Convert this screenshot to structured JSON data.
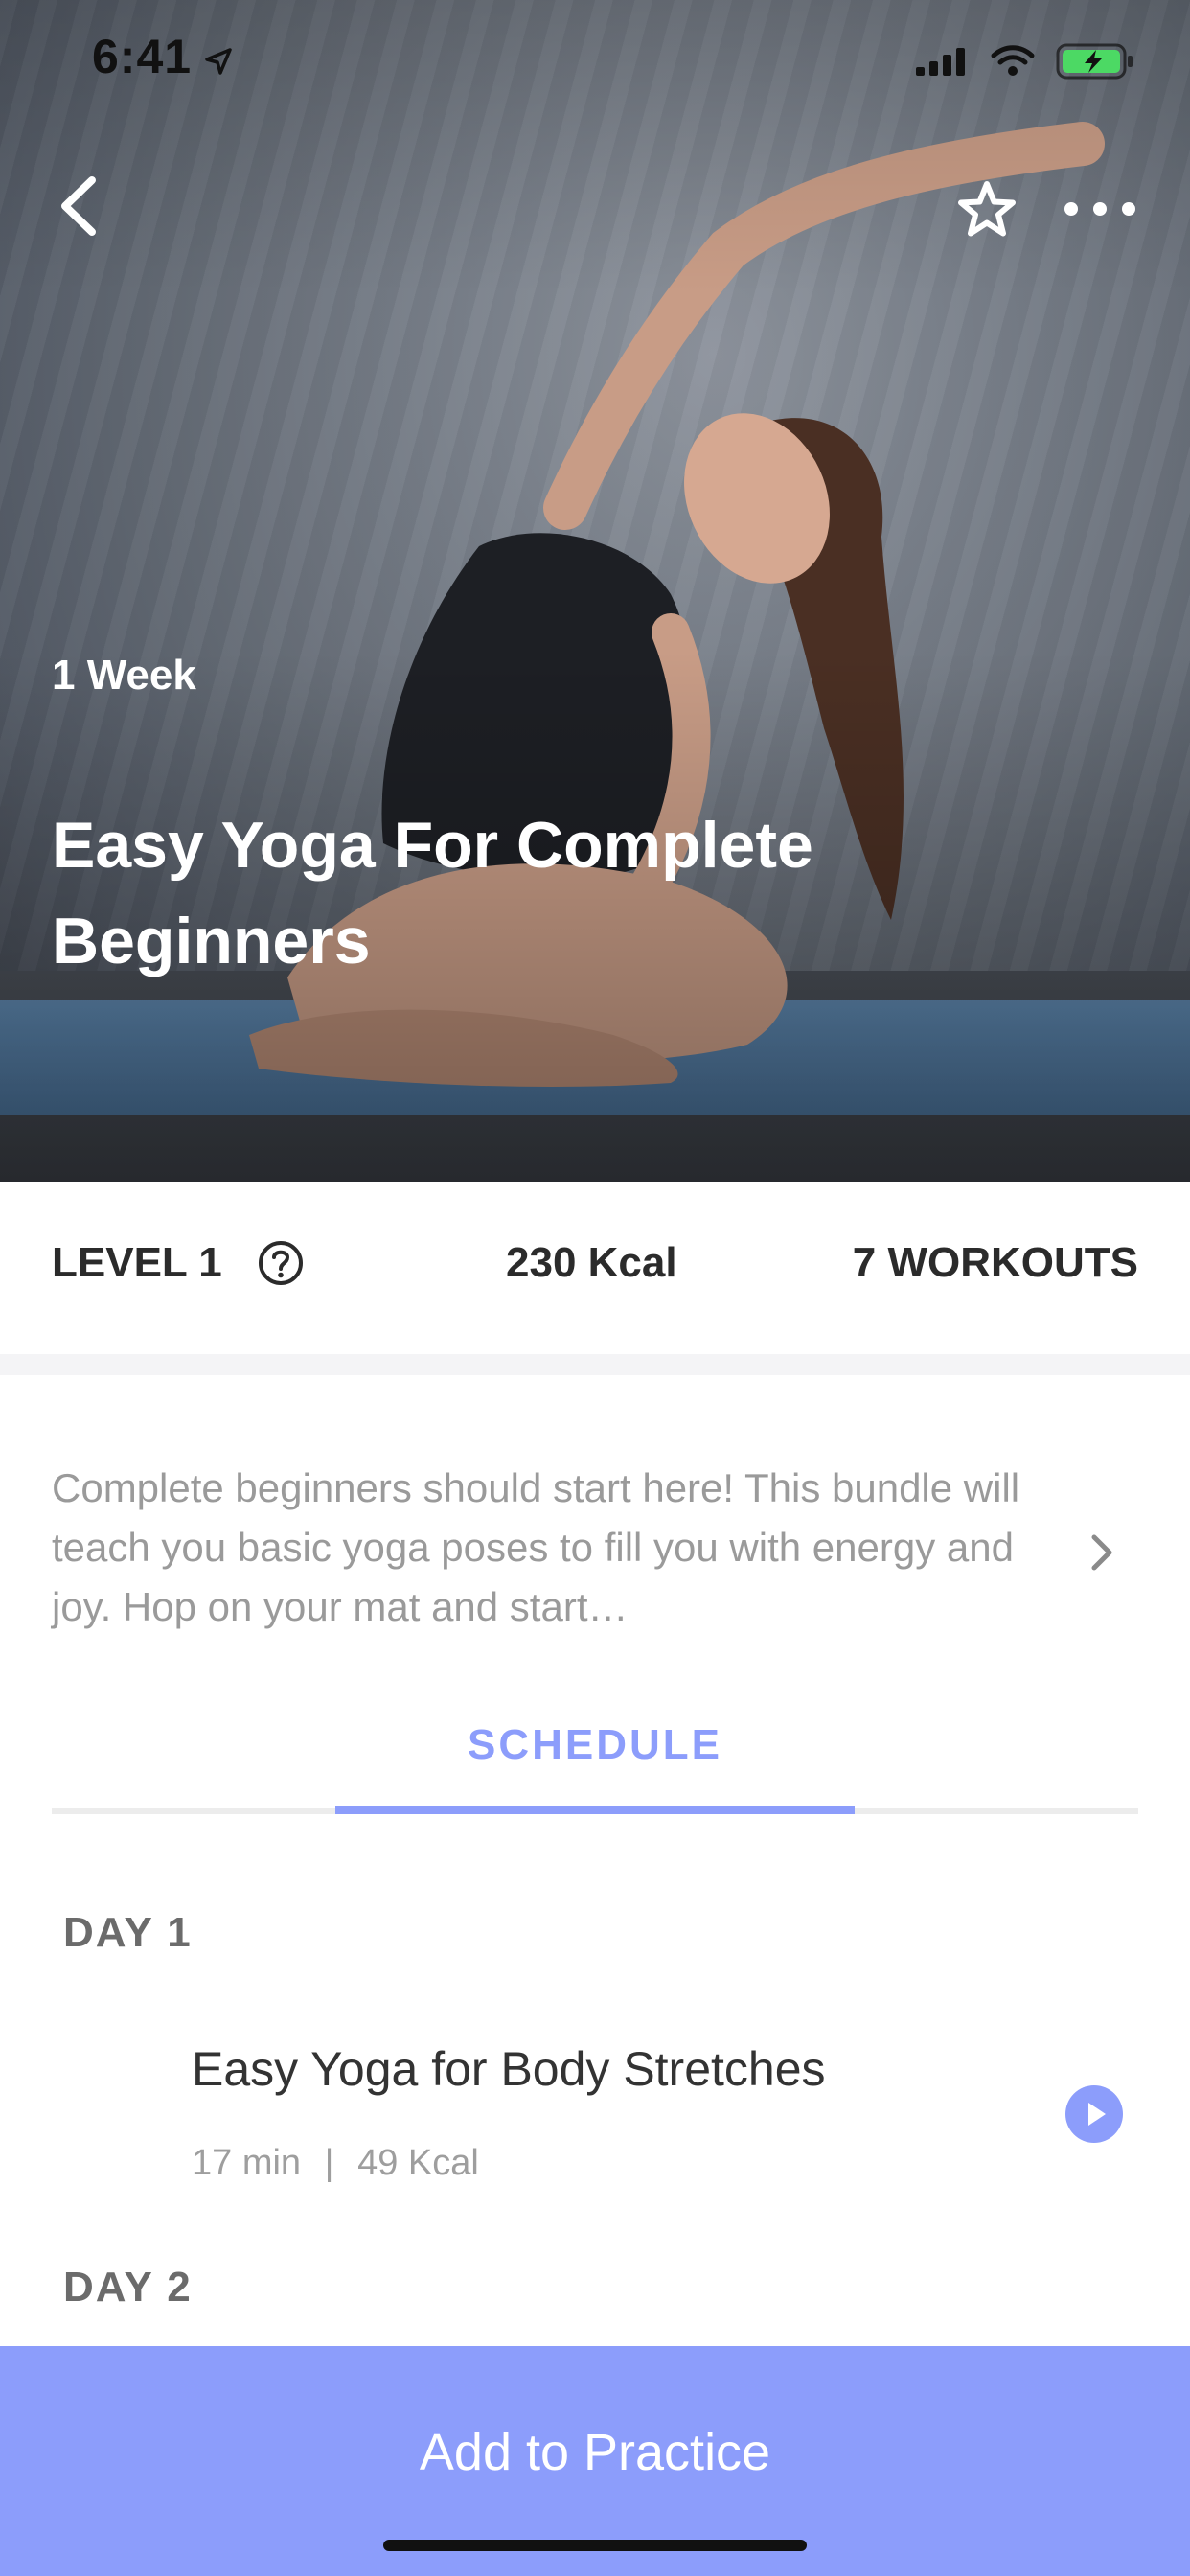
{
  "status_bar": {
    "time": "6:41"
  },
  "hero": {
    "duration": "1 Week",
    "title": "Easy Yoga For Complete Beginners"
  },
  "stats": {
    "level": "LEVEL 1",
    "kcal": "230 Kcal",
    "workouts": "7 WORKOUTS"
  },
  "description": "Complete beginners should start here! This bundle will teach you basic yoga poses to fill you with energy and joy. Hop on your mat and start…",
  "tabs": [
    {
      "label": "SCHEDULE",
      "active": true
    }
  ],
  "schedule": [
    {
      "day": "DAY 1",
      "workouts": [
        {
          "title": "Easy Yoga for Body Stretches",
          "duration": "17 min",
          "kcal": "49 Kcal"
        }
      ]
    },
    {
      "day": "DAY 2",
      "workouts": []
    }
  ],
  "cta": {
    "label": "Add to Practice"
  },
  "colors": {
    "accent": "#8c9dfb",
    "text_dark": "#2b2b2b",
    "text_muted": "#9a9a9a",
    "battery": "#4cd964"
  },
  "icons": {
    "back": "chevron-left-icon",
    "favorite": "star-outline-icon",
    "more": "ellipsis-icon",
    "help": "question-circle-icon",
    "expand": "chevron-right-icon",
    "play": "play-circle-icon"
  }
}
